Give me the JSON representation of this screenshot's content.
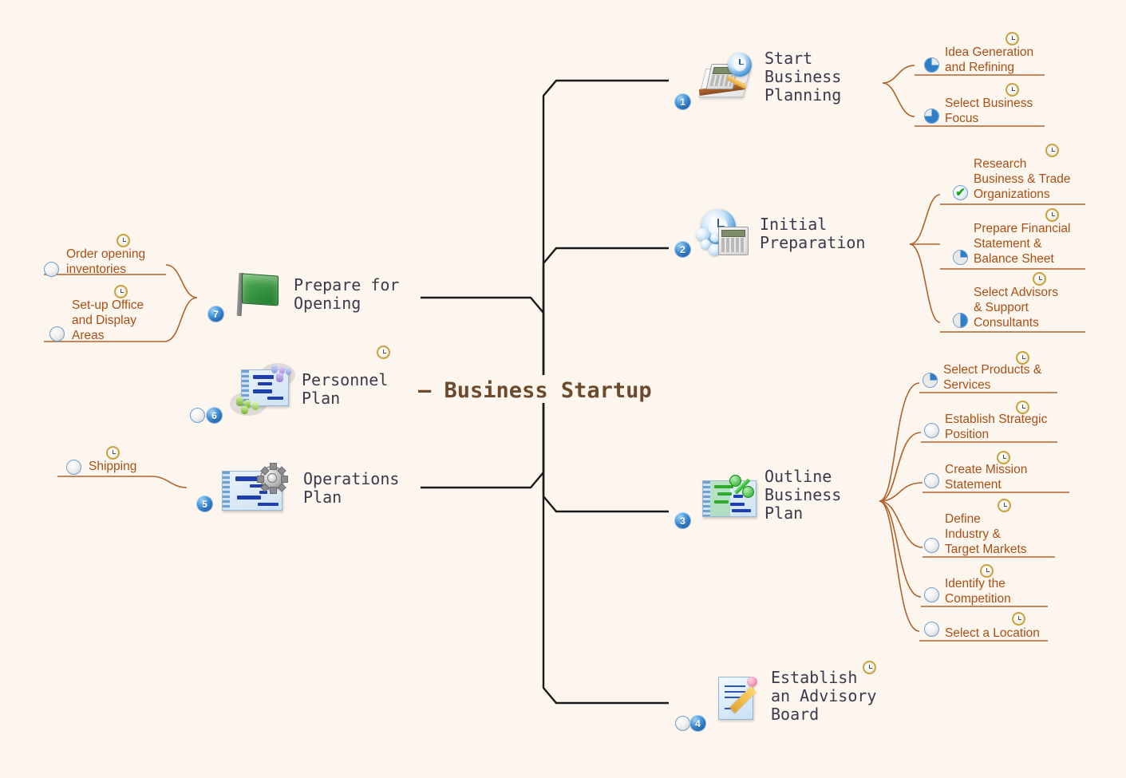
{
  "theme": {
    "background": "#fdf6ef",
    "center_text_color": "#6d4a2c",
    "main_text_color": "#3a3a4a",
    "sub_text_color": "#a94f14",
    "sub_line_color": "#b0622a",
    "main_line_color": "#1a1a1a",
    "badge_color": "#2f7fc8",
    "check_color": "#17a317"
  },
  "center": {
    "dash": "—",
    "title": "Business Startup"
  },
  "main_topics": [
    {
      "id": "start-business-planning",
      "label": "Start\nBusiness\nPlanning",
      "number": "1",
      "icon": "calculator-clock-ruler-icon",
      "side": "right",
      "progress_marker": "none",
      "subtopics": [
        {
          "label": "Idea Generation\nand Refining",
          "progress": 75,
          "marker": "pie",
          "clock": true
        },
        {
          "label": "Select Business\nFocus",
          "progress": 75,
          "marker": "pie",
          "clock": true
        }
      ]
    },
    {
      "id": "initial-preparation",
      "label": "Initial\nPreparation",
      "number": "2",
      "icon": "clock-people-calculator-icon",
      "side": "right",
      "progress_marker": "none",
      "subtopics": [
        {
          "label": "Research\nBusiness & Trade\nOrganizations",
          "progress": 100,
          "marker": "check",
          "clock": true
        },
        {
          "label": "Prepare Financial\nStatement &\nBalance Sheet",
          "progress": 25,
          "marker": "pie",
          "clock": true
        },
        {
          "label": "Select Advisors\n& Support\nConsultants",
          "progress": 50,
          "marker": "pie",
          "clock": true
        }
      ]
    },
    {
      "id": "outline-business-plan",
      "label": "Outline\nBusiness\nPlan",
      "number": "3",
      "icon": "gantt-percent-icon",
      "side": "right",
      "progress_marker": "none",
      "subtopics": [
        {
          "label": "Select Products &\nServices",
          "progress": 25,
          "marker": "pie",
          "clock": true
        },
        {
          "label": "Establish Strategic\nPosition",
          "progress": 0,
          "marker": "pie",
          "clock": true
        },
        {
          "label": "Create Mission\nStatement",
          "progress": 0,
          "marker": "pie",
          "clock": true
        },
        {
          "label": "Define\nIndustry &\nTarget Markets",
          "progress": 0,
          "marker": "pie",
          "clock": true
        },
        {
          "label": "Identify the\nCompetition",
          "progress": 0,
          "marker": "pie",
          "clock": true
        },
        {
          "label": "Select a Location",
          "progress": 0,
          "marker": "pie",
          "clock": true
        }
      ]
    },
    {
      "id": "establish-an-advisory-board",
      "label": "Establish\nan Advisory\nBoard",
      "number": "4",
      "icon": "document-pencil-icon",
      "side": "right",
      "progress_marker": "pie",
      "progress": 0,
      "clock": true,
      "subtopics": []
    },
    {
      "id": "operations-plan",
      "label": "Operations\nPlan",
      "number": "5",
      "icon": "gantt-gear-icon",
      "side": "left",
      "progress_marker": "none",
      "subtopics": [
        {
          "label": "Shipping",
          "progress": 0,
          "marker": "pie",
          "clock": true
        }
      ]
    },
    {
      "id": "personnel-plan",
      "label": "Personnel\nPlan",
      "number": "6",
      "icon": "gantt-people-icon",
      "side": "left",
      "progress_marker": "pie",
      "progress": 0,
      "clock": true,
      "subtopics": []
    },
    {
      "id": "prepare-for-opening",
      "label": "Prepare for\nOpening",
      "number": "7",
      "icon": "green-flag-icon",
      "side": "left",
      "progress_marker": "none",
      "subtopics": [
        {
          "label": "Order opening\ninventories",
          "progress": 0,
          "marker": "pie",
          "clock": true
        },
        {
          "label": "Set-up Office\nand Display\nAreas",
          "progress": 0,
          "marker": "pie",
          "clock": true
        }
      ]
    }
  ]
}
